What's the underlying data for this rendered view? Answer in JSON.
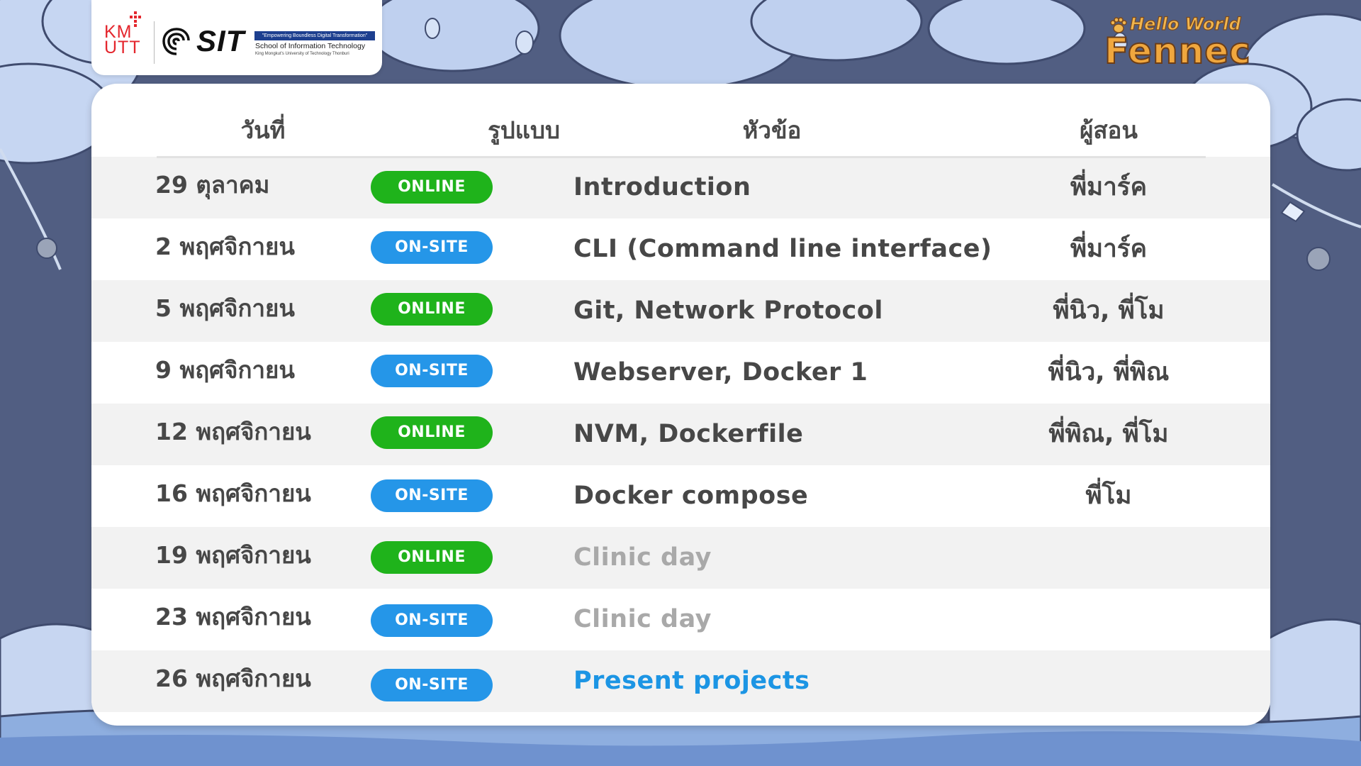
{
  "brand": {
    "kmutt_line1": "KM",
    "kmutt_line2": "UTT",
    "sit_name": "SIT",
    "sit_tagline": "\"Empowering Boundless Digital Transformation\"",
    "sit_school": "School of Information Technology",
    "sit_university": "King Mongkut's University of Technology Thonburi",
    "event_tagline": "Hello World",
    "event_name": "Fennec"
  },
  "table": {
    "headers": {
      "date": "วันที่",
      "format": "รูปแบบ",
      "topic": "หัวข้อ",
      "instructor": "ผู้สอน"
    },
    "rows": [
      {
        "date": "29 ตุลาคม",
        "format": "ONLINE",
        "topic": "Introduction",
        "instructor": "พี่มาร์ค"
      },
      {
        "date": "2 พฤศจิกายน",
        "format": "ON-SITE",
        "topic": "CLI (Command line interface)",
        "instructor": "พี่มาร์ค"
      },
      {
        "date": "5 พฤศจิกายน",
        "format": "ONLINE",
        "topic": "Git, Network Protocol",
        "instructor": "พี่นิว, พี่โม"
      },
      {
        "date": "9 พฤศจิกายน",
        "format": "ON-SITE",
        "topic": "Webserver, Docker 1",
        "instructor": "พี่นิว, พี่พิณ"
      },
      {
        "date": "12 พฤศจิกายน",
        "format": "ONLINE",
        "topic": "NVM, Dockerfile",
        "instructor": "พี่พิณ, พี่โม"
      },
      {
        "date": "16 พฤศจิกายน",
        "format": "ON-SITE",
        "topic": "Docker compose",
        "instructor": "พี่โม"
      },
      {
        "date": "19 พฤศจิกายน",
        "format": "ONLINE",
        "topic": "Clinic day",
        "instructor": ""
      },
      {
        "date": "23 พฤศจิกายน",
        "format": "ON-SITE",
        "topic": "Clinic day",
        "instructor": ""
      },
      {
        "date": "26 พฤศจิกายน",
        "format": "ON-SITE",
        "topic": "Present projects",
        "instructor": ""
      }
    ]
  },
  "colors": {
    "online_badge": "#1fb31b",
    "onsite_badge": "#2596e8",
    "text_primary": "#474747",
    "text_muted": "#a9a9a9",
    "text_highlight": "#1c95e4",
    "background_navy": "#515e82",
    "cloud_blue": "#8eaedf"
  }
}
